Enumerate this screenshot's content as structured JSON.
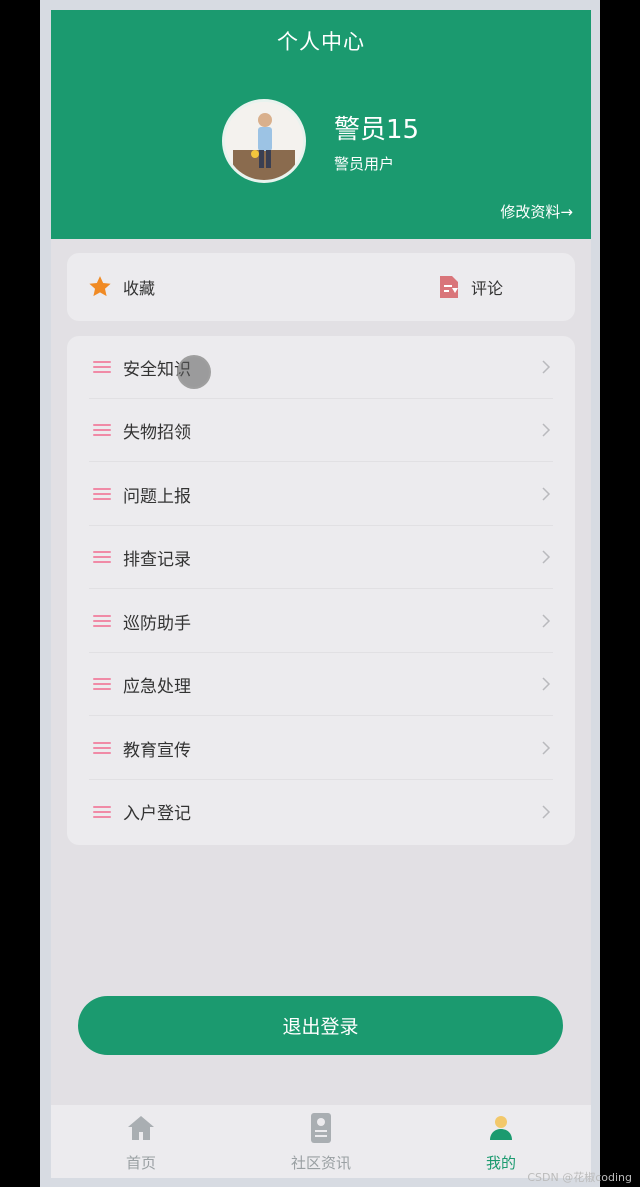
{
  "header": {
    "title": "个人中心",
    "user_name": "警员15",
    "user_role": "警员用户",
    "edit_link": "修改资料→"
  },
  "quick_actions": {
    "favorites": {
      "label": "收藏",
      "icon": "star-icon"
    },
    "comments": {
      "label": "评论",
      "icon": "document-edit-icon"
    }
  },
  "menu": {
    "items": [
      {
        "label": "安全知识"
      },
      {
        "label": "失物招领"
      },
      {
        "label": "问题上报"
      },
      {
        "label": "排查记录"
      },
      {
        "label": "巡防助手"
      },
      {
        "label": "应急处理"
      },
      {
        "label": "教育宣传"
      },
      {
        "label": "入户登记"
      }
    ]
  },
  "logout_label": "退出登录",
  "tabbar": {
    "items": [
      {
        "label": "首页",
        "icon": "home-icon"
      },
      {
        "label": "社区资讯",
        "icon": "news-icon"
      },
      {
        "label": "我的",
        "icon": "user-icon",
        "active": true
      }
    ]
  },
  "watermark": "CSDN @花椒coding",
  "colors": {
    "primary": "#1b9a6f",
    "menu_icon": "#f08aa6",
    "star": "#f08a24",
    "comment_icon": "#d9757a"
  }
}
